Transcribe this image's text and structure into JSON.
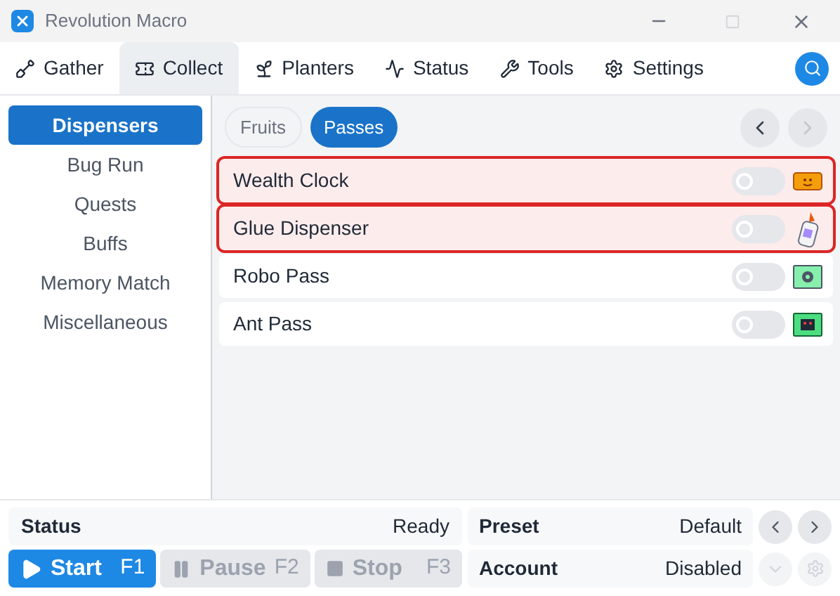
{
  "window": {
    "title": "Revolution Macro"
  },
  "tabs": [
    {
      "label": "Gather",
      "kind": "shovel",
      "selected": false
    },
    {
      "label": "Collect",
      "kind": "ticket",
      "selected": true
    },
    {
      "label": "Planters",
      "kind": "plant",
      "selected": false
    },
    {
      "label": "Status",
      "kind": "pulse",
      "selected": false
    },
    {
      "label": "Tools",
      "kind": "wrench",
      "selected": false
    },
    {
      "label": "Settings",
      "kind": "gear",
      "selected": false
    }
  ],
  "sidebar": {
    "items": [
      {
        "label": "Dispensers",
        "selected": true
      },
      {
        "label": "Bug Run",
        "selected": false
      },
      {
        "label": "Quests",
        "selected": false
      },
      {
        "label": "Buffs",
        "selected": false
      },
      {
        "label": "Memory Match",
        "selected": false
      },
      {
        "label": "Miscellaneous",
        "selected": false
      }
    ]
  },
  "subtabs": [
    {
      "label": "Fruits",
      "selected": false
    },
    {
      "label": "Passes",
      "selected": true
    }
  ],
  "pager": {
    "prev_disabled": false,
    "next_disabled": true
  },
  "items": [
    {
      "label": "Wealth Clock",
      "on": false,
      "highlighted": true,
      "kind": "clock"
    },
    {
      "label": "Glue Dispenser",
      "on": false,
      "highlighted": true,
      "kind": "glue"
    },
    {
      "label": "Robo Pass",
      "on": false,
      "highlighted": false,
      "kind": "robo"
    },
    {
      "label": "Ant Pass",
      "on": false,
      "highlighted": false,
      "kind": "ant"
    }
  ],
  "status": {
    "label": "Status",
    "value": "Ready"
  },
  "controls": [
    {
      "label": "Start",
      "key": "F1",
      "disabled": false,
      "kind": "play"
    },
    {
      "label": "Pause",
      "key": "F2",
      "disabled": true,
      "kind": "pause"
    },
    {
      "label": "Stop",
      "key": "F3",
      "disabled": true,
      "kind": "stop"
    }
  ],
  "preset": {
    "label": "Preset",
    "value": "Default",
    "disabled": false
  },
  "account": {
    "label": "Account",
    "value": "Disabled",
    "disabled": true
  }
}
